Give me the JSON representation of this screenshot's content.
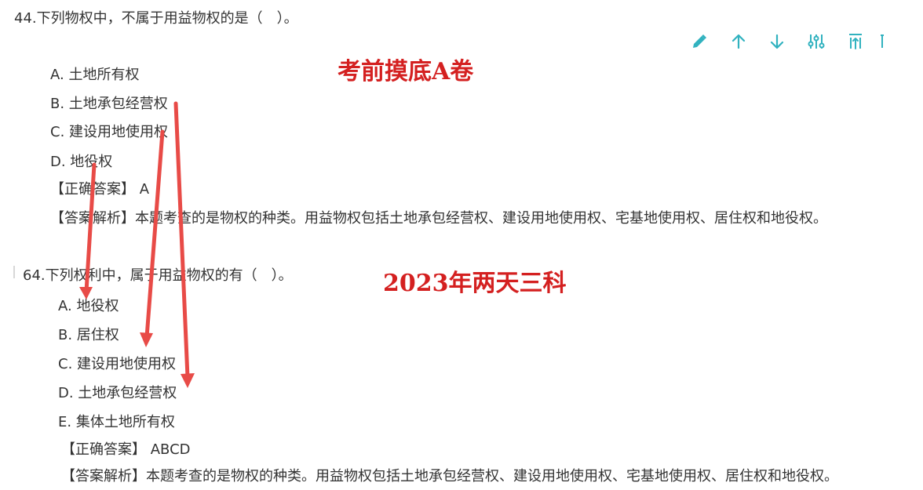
{
  "question_1": {
    "title": "44.下列物权中，不属于用益物权的是（　）。",
    "options": [
      "A. 土地所有权",
      "B. 土地承包经营权",
      "C. 建设用地使用权",
      "D. 地役权"
    ],
    "answer": "【正确答案】 A",
    "explanation": "【答案解析】本题考查的是物权的种类。用益物权包括土地承包经营权、建设用地使用权、宅基地使用权、居住权和地役权。"
  },
  "question_2": {
    "title": "64.下列权利中，属于用益物权的有（　）。",
    "options": [
      "A. 地役权",
      "B. 居住权",
      "C. 建设用地使用权",
      "D. 土地承包经营权",
      "E. 集体土地所有权"
    ],
    "answer": "【正确答案】 ABCD",
    "explanation": "【答案解析】本题考查的是物权的种类。用益物权包括土地承包经营权、建设用地使用权、宅基地使用权、居住权和地役权。"
  },
  "overlay": {
    "label_1": "考前摸底A卷",
    "label_2": "2023年两天三科"
  },
  "toolbar": {
    "icons": [
      "pencil-icon",
      "arrow-up-icon",
      "arrow-down-icon",
      "sliders-icon",
      "sort-up-icon",
      "more-icon"
    ]
  },
  "colors": {
    "text": "#333333",
    "toolbar": "#31b2bf",
    "overlay_red": "#d42020",
    "arrow_red": "#e84b47"
  }
}
